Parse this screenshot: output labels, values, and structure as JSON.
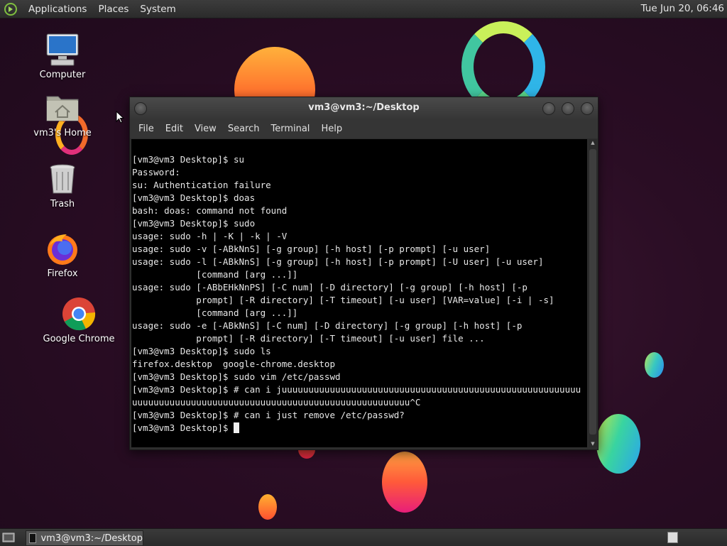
{
  "top_panel": {
    "menus": [
      "Applications",
      "Places",
      "System"
    ],
    "clock": "Tue Jun 20, 06:46"
  },
  "desktop_icons": [
    {
      "label": "Computer",
      "icon": "computer-icon"
    },
    {
      "label": "vm3's Home",
      "icon": "home-folder-icon"
    },
    {
      "label": "Trash",
      "icon": "trash-icon"
    },
    {
      "label": "Firefox",
      "icon": "firefox-icon"
    },
    {
      "label": "Google Chrome",
      "icon": "chrome-icon"
    }
  ],
  "terminal": {
    "title": "vm3@vm3:~/Desktop",
    "menu": [
      "File",
      "Edit",
      "View",
      "Search",
      "Terminal",
      "Help"
    ],
    "lines": [
      "[vm3@vm3 Desktop]$ su",
      "Password:",
      "su: Authentication failure",
      "[vm3@vm3 Desktop]$ doas",
      "bash: doas: command not found",
      "[vm3@vm3 Desktop]$ sudo",
      "usage: sudo -h | -K | -k | -V",
      "usage: sudo -v [-ABkNnS] [-g group] [-h host] [-p prompt] [-u user]",
      "usage: sudo -l [-ABkNnS] [-g group] [-h host] [-p prompt] [-U user] [-u user]",
      "            [command [arg ...]]",
      "usage: sudo [-ABbEHkNnPS] [-C num] [-D directory] [-g group] [-h host] [-p",
      "            prompt] [-R directory] [-T timeout] [-u user] [VAR=value] [-i | -s]",
      "            [command [arg ...]]",
      "usage: sudo -e [-ABkNnS] [-C num] [-D directory] [-g group] [-h host] [-p",
      "            prompt] [-R directory] [-T timeout] [-u user] file ...",
      "[vm3@vm3 Desktop]$ sudo ls",
      "firefox.desktop  google-chrome.desktop",
      "[vm3@vm3 Desktop]$ sudo vim /etc/passwd",
      "[vm3@vm3 Desktop]$ # can i juuuuuuuuuuuuuuuuuuuuuuuuuuuuuuuuuuuuuuuuuuuuuuuuuuuuuuuu",
      "uuuuuuuuuuuuuuuuuuuuuuuuuuuuuuuuuuuuuuuuuuuuuuuuuuuu^C",
      "[vm3@vm3 Desktop]$ # can i just remove /etc/passwd?"
    ],
    "prompt": "[vm3@vm3 Desktop]$ "
  },
  "bottom_panel": {
    "task_label": "vm3@vm3:~/Desktop"
  }
}
